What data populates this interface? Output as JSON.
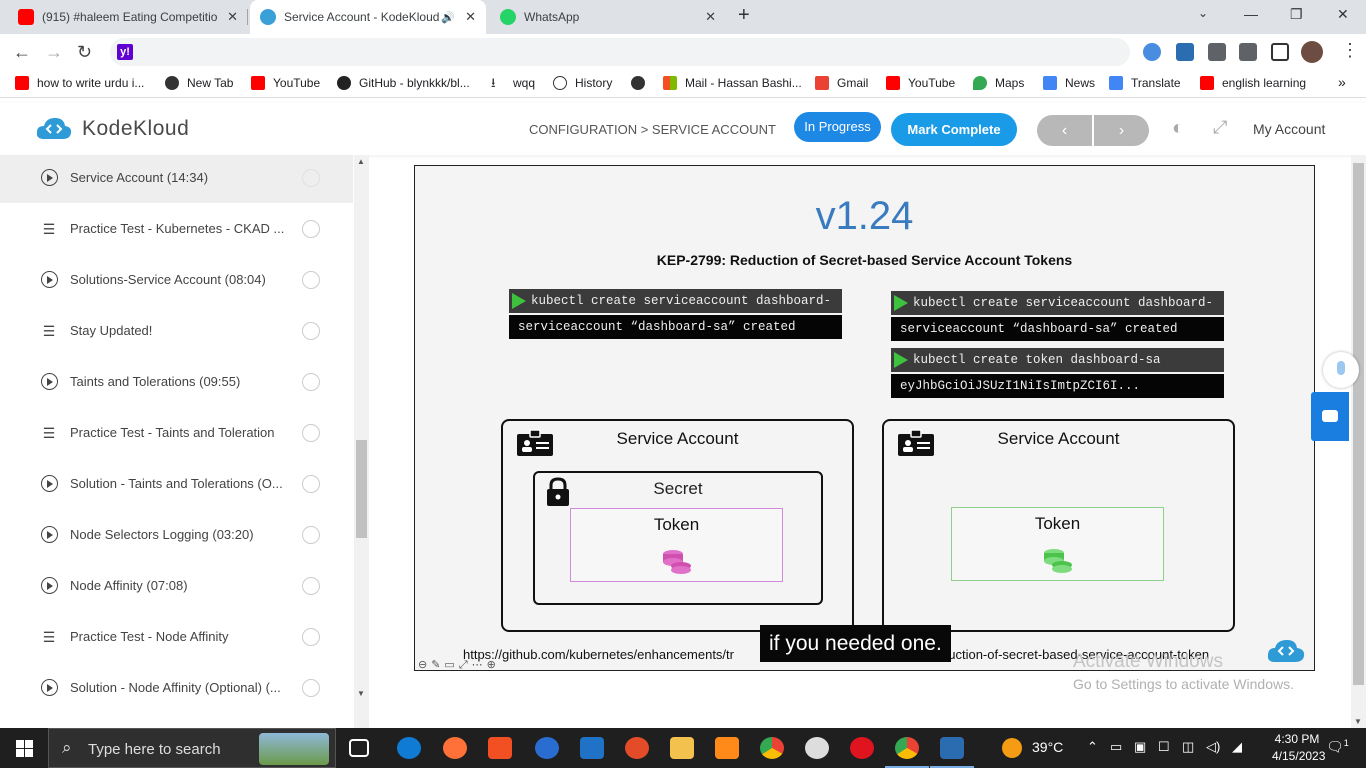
{
  "browser": {
    "tabs": [
      {
        "title": "(915) #haleem Eating Competitio",
        "icon": "youtube-icon",
        "color": "#ff0000"
      },
      {
        "title": "Service Account - KodeKloud",
        "icon": "kodekloud-icon",
        "color": "#39a0d8",
        "active": true
      },
      {
        "title": "WhatsApp",
        "icon": "whatsapp-icon",
        "color": "#25d366"
      }
    ],
    "new_tab": "+",
    "address": "",
    "bookmarks": [
      {
        "label": "how to write urdu i...",
        "icon": "youtube-icon",
        "color": "#ff0000"
      },
      {
        "label": "New Tab",
        "icon": "globe-icon",
        "color": "#333333"
      },
      {
        "label": "YouTube",
        "icon": "youtube-icon",
        "color": "#ff0000"
      },
      {
        "label": "GitHub - blynkkk/bl...",
        "icon": "github-icon",
        "color": "#222222"
      },
      {
        "label": "wqq",
        "icon": "download-icon",
        "color": "#333333"
      },
      {
        "label": "History",
        "icon": "history-icon",
        "color": "#333333"
      },
      {
        "label": "",
        "icon": "globe-icon",
        "color": "#333333"
      },
      {
        "label": "Mail - Hassan Bashi...",
        "icon": "microsoft-icon",
        "color": "#f25022"
      },
      {
        "label": "Gmail",
        "icon": "gmail-icon",
        "color": "#ea4335"
      },
      {
        "label": "YouTube",
        "icon": "youtube-icon",
        "color": "#ff0000"
      },
      {
        "label": "Maps",
        "icon": "maps-icon",
        "color": "#34a853"
      },
      {
        "label": "News",
        "icon": "news-icon",
        "color": "#4285f4"
      },
      {
        "label": "Translate",
        "icon": "translate-icon",
        "color": "#4285f4"
      },
      {
        "label": "english learning",
        "icon": "youtube-icon",
        "color": "#ff0000"
      }
    ],
    "bookmarks_more": "»"
  },
  "header": {
    "brand": "KodeKloud",
    "breadcrumb": "CONFIGURATION > SERVICE ACCOUNT",
    "status": "In Progress",
    "mark_complete": "Mark Complete",
    "prev": "‹",
    "next": "›",
    "account": "My Account",
    "accent": "#1a9be8"
  },
  "sidebar": {
    "items": [
      {
        "label": "Service Account (14:34)",
        "type": "video",
        "selected": true
      },
      {
        "label": "Practice Test - Kubernetes - CKAD ...",
        "type": "lab"
      },
      {
        "label": "Solutions-Service Account (08:04)",
        "type": "video"
      },
      {
        "label": "Stay Updated!",
        "type": "lab"
      },
      {
        "label": "Taints and Tolerations (09:55)",
        "type": "video"
      },
      {
        "label": "Practice Test - Taints and Toleration",
        "type": "lab"
      },
      {
        "label": "Solution - Taints and Tolerations (O...",
        "type": "video"
      },
      {
        "label": "Node Selectors Logging (03:20)",
        "type": "video"
      },
      {
        "label": "Node Affinity (07:08)",
        "type": "video"
      },
      {
        "label": "Practice Test - Node Affinity",
        "type": "lab"
      },
      {
        "label": "Solution - Node Affinity (Optional) (...",
        "type": "video"
      }
    ]
  },
  "video": {
    "version": "v1.24",
    "subtitle": "KEP-2799: Reduction of Secret-based Service Account Tokens",
    "left_cmd": "kubectl create serviceaccount dashboard-sa",
    "left_out": "serviceaccount “dashboard-sa” created",
    "right_cmd1": "kubectl create serviceaccount dashboard-sa",
    "right_out1": "serviceaccount “dashboard-sa” created",
    "right_cmd2": "kubectl create token dashboard-sa",
    "right_out2": "eyJhbGciOiJSUzI1NiIsImtpZCI6I...",
    "sa_label": "Service Account",
    "secret_label": "Secret",
    "token_label": "Token",
    "url": "https://github.com/kubernetes/enhancements/tr",
    "url_tail": "duction-of-secret-based-service-account-token",
    "caption": "if you needed one."
  },
  "activation": {
    "line1": "Activate Windows",
    "line2": "Go to Settings to activate Windows."
  },
  "taskbar": {
    "search_placeholder": "Type here to search",
    "weather": "39°C",
    "time": "4:30 PM",
    "date": "4/15/2023",
    "notifications": "1"
  }
}
